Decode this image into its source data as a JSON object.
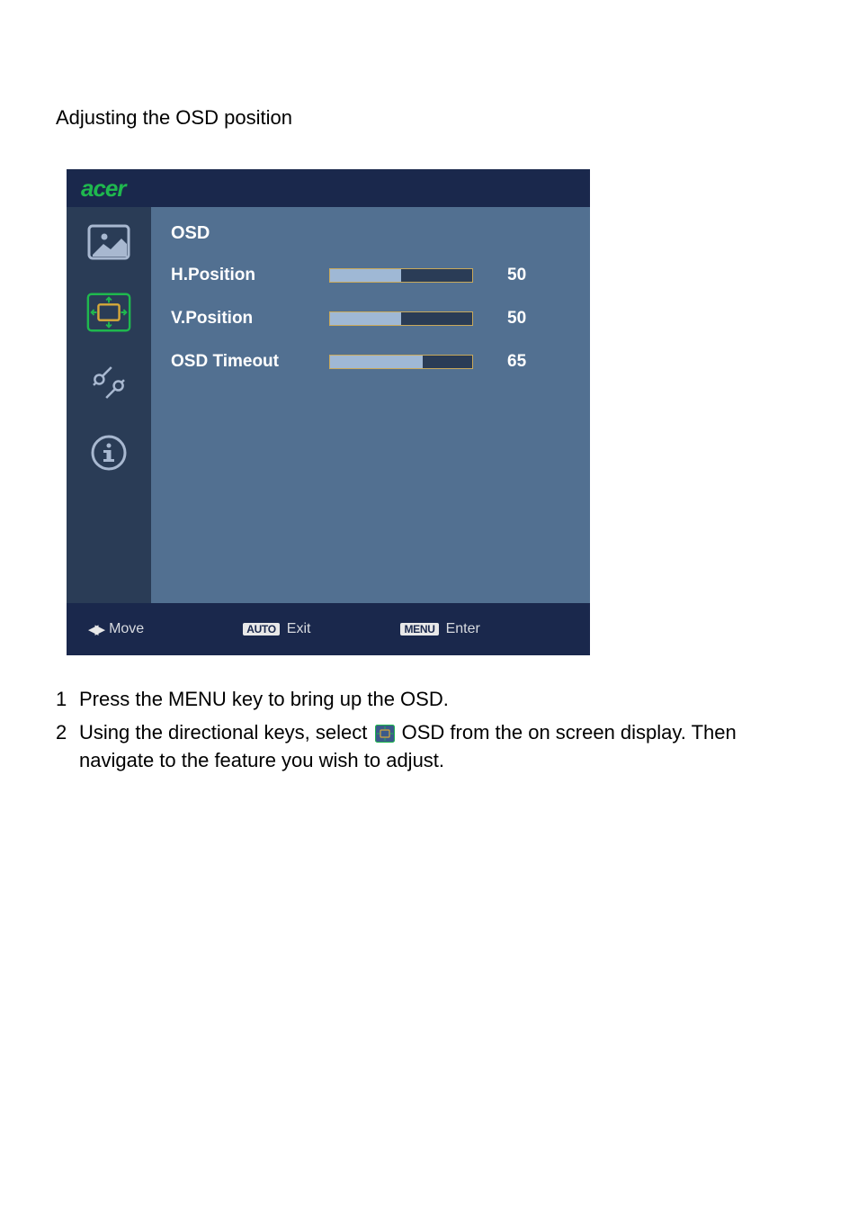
{
  "heading": "Adjusting the OSD position",
  "brand": "acer",
  "section_title": "OSD",
  "settings": [
    {
      "label": "H.Position",
      "value": "50",
      "fill_pct": 50
    },
    {
      "label": "V.Position",
      "value": "50",
      "fill_pct": 50
    },
    {
      "label": "OSD Timeout",
      "value": "65",
      "fill_pct": 65
    }
  ],
  "footer": {
    "move": "Move",
    "exit_badge": "AUTO",
    "exit": "Exit",
    "enter_badge": "MENU",
    "enter": "Enter"
  },
  "instructions": [
    {
      "num": "1",
      "text": "Press the MENU key to bring up the OSD."
    },
    {
      "num": "2",
      "pre": "Using the directional keys, select ",
      "post": " OSD from the on screen display. Then navigate to the feature you wish to adjust."
    }
  ]
}
